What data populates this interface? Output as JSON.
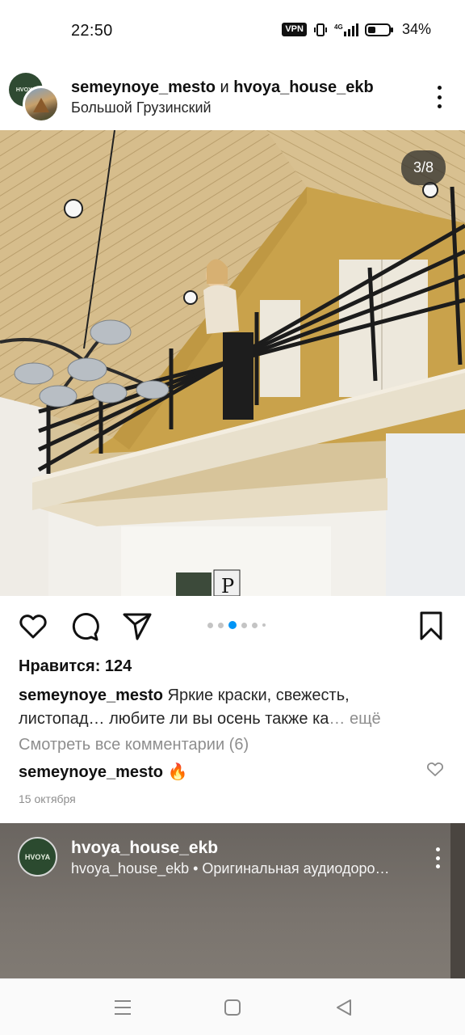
{
  "status_bar": {
    "time": "22:50",
    "vpn": "VPN",
    "network": "4G",
    "battery": "34%"
  },
  "post": {
    "author_primary": "semeynoye_mesto",
    "joiner": "и",
    "author_secondary": "hvoya_house_ekb",
    "avatar_back_text": "HVOYA",
    "location": "Большой Грузинский",
    "page_indicator": "3/8",
    "carousel": {
      "count": 6,
      "active": 2
    },
    "likes": "Нравится: 124",
    "caption_user": "semeynoye_mesto",
    "caption_text": "Яркие краски, свежесть, листопад… любите ли вы осень также ка",
    "caption_more": "… ещё",
    "view_comments": "Смотреть все комментарии (6)",
    "comment_user": "semeynoye_mesto",
    "comment_text": "🔥",
    "date": "15 октября"
  },
  "next_post": {
    "avatar_text": "HVOYA",
    "username": "hvoya_house_ekb",
    "subtitle": "hvoya_house_ekb • Оригинальная аудиодоро…"
  },
  "icons": {
    "like": "heart-icon",
    "comment": "comment-icon",
    "share": "send-icon",
    "save": "bookmark-icon",
    "nav_menu": "menu-icon",
    "nav_home": "square-icon",
    "nav_back": "back-triangle-icon"
  },
  "colors": {
    "active_dot": "#0095f6",
    "inactive_dot": "#c4c4c4",
    "text": "#262626",
    "muted": "#8e8e8e"
  }
}
